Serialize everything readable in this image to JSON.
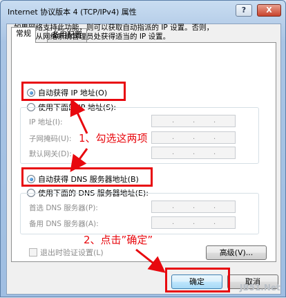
{
  "window": {
    "title": "Internet 协议版本 4 (TCP/IPv4) 属性",
    "help_label": "?",
    "close_label": "X"
  },
  "tabs": [
    {
      "label": "常规",
      "selected": true
    },
    {
      "label": "备用配置",
      "selected": false
    }
  ],
  "description": {
    "line1": "如果网络支持此功能，则可以获取自动指派的 IP 设置。否则，",
    "line2": "您需要从网络系统管理员处获得适当的 IP 设置。"
  },
  "ip_options": {
    "auto": {
      "label": "自动获得 IP 地址(O)",
      "selected": true
    },
    "manual": {
      "label": "使用下面的 IP 地址(S):",
      "selected": false
    },
    "fields": [
      {
        "label": "IP 地址(I):",
        "value": ". . ."
      },
      {
        "label": "子网掩码(U):",
        "value": ". . ."
      },
      {
        "label": "默认网关(D):",
        "value": ". . ."
      }
    ]
  },
  "dns_options": {
    "auto": {
      "label": "自动获得 DNS 服务器地址(B)",
      "selected": true
    },
    "manual": {
      "label": "使用下面的 DNS 服务器地址(E):",
      "selected": false
    },
    "fields": [
      {
        "label": "首选 DNS 服务器(P):",
        "value": ". . ."
      },
      {
        "label": "备用 DNS 服务器(A):",
        "value": ". . ."
      }
    ]
  },
  "validate_checkbox": {
    "label": "退出时验证设置(L)",
    "checked": false
  },
  "advanced_button": "高级(V)...",
  "footer": {
    "ok_label": "确定",
    "cancel_label": "取消"
  },
  "annotations": {
    "step1": "1、勾选这两项",
    "step2": "2、点击”确定”",
    "highlight_color": "#e8080e"
  },
  "watermark": "JB51.Net"
}
